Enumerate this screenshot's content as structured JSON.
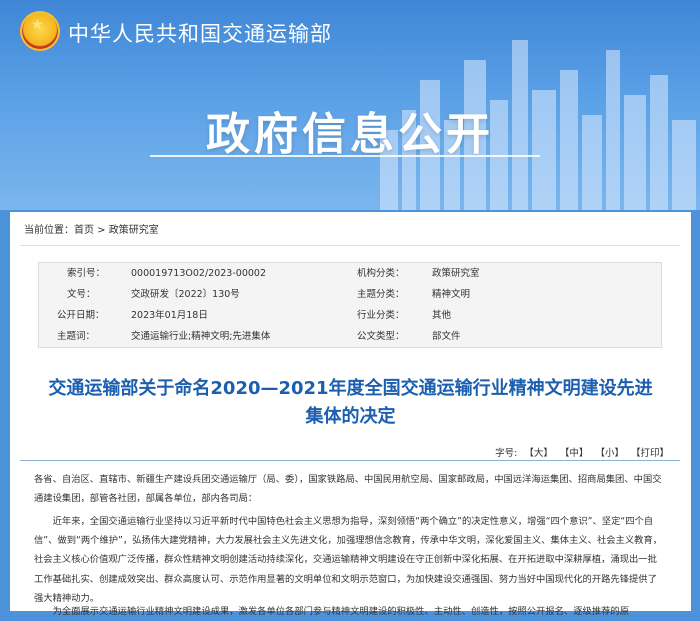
{
  "header": {
    "ministry_name": "中华人民共和国交通运输部",
    "banner_title": "政府信息公开"
  },
  "breadcrumb": {
    "prefix": "当前位置：",
    "home": "首页",
    "sep": " > ",
    "current": "政策研究室"
  },
  "meta": {
    "index_label": "索引号：",
    "index_value": "000019713O02/2023-00002",
    "agency_label": "机构分类：",
    "agency_value": "政策研究室",
    "docno_label": "文号：",
    "docno_value": "交政研发〔2022〕130号",
    "topic_label": "主题分类：",
    "topic_value": "精神文明",
    "date_label": "公开日期：",
    "date_value": "2023年01月18日",
    "industry_label": "行业分类：",
    "industry_value": "其他",
    "keywords_label": "主题词：",
    "keywords_value": "交通运输行业;精神文明;先进集体",
    "type_label": "公文类型：",
    "type_value": "部文件"
  },
  "document": {
    "title_line1": "交通运输部关于命名2020—2021年度全国交通运输行业精神文明建设先进",
    "title_line2": "集体的决定",
    "font_label": "字号:",
    "font_large": "【大】",
    "font_medium": "【中】",
    "font_small": "【小】",
    "print": "【打印】",
    "para1": "各省、自治区、直辖市、新疆生产建设兵团交通运输厅（局、委），国家铁路局、中国民用航空局、国家邮政局，中国远洋海运集团、招商局集团、中国交通建设集团，部管各社团，部属各单位，部内各司局：",
    "para2": "近年来，全国交通运输行业坚持以习近平新时代中国特色社会主义思想为指导，深刻领悟“两个确立”的决定性意义，增强“四个意识”、坚定“四个自信”、做到“两个维护”，弘扬伟大建党精神，大力发展社会主义先进文化，加强理想信念教育，传承中华文明，深化爱国主义、集体主义、社会主义教育，社会主义核心价值观广泛传播，群众性精神文明创建活动持续深化，交通运输精神文明建设在守正创新中深化拓展、在开拓进取中深耕厚植，涌现出一批工作基础扎实、创建成效突出、群众高度认可、示范作用显著的文明单位和文明示范窗口，为加快建设交通强国、努力当好中国现代化的开路先锋提供了强大精神动力。",
    "para3": "为全面展示交通运输行业精神文明建设成果，激发各单位各部门参与精神文明建设的积极性、主动性、创造性，按照公开报名、逐级推荐的原"
  }
}
